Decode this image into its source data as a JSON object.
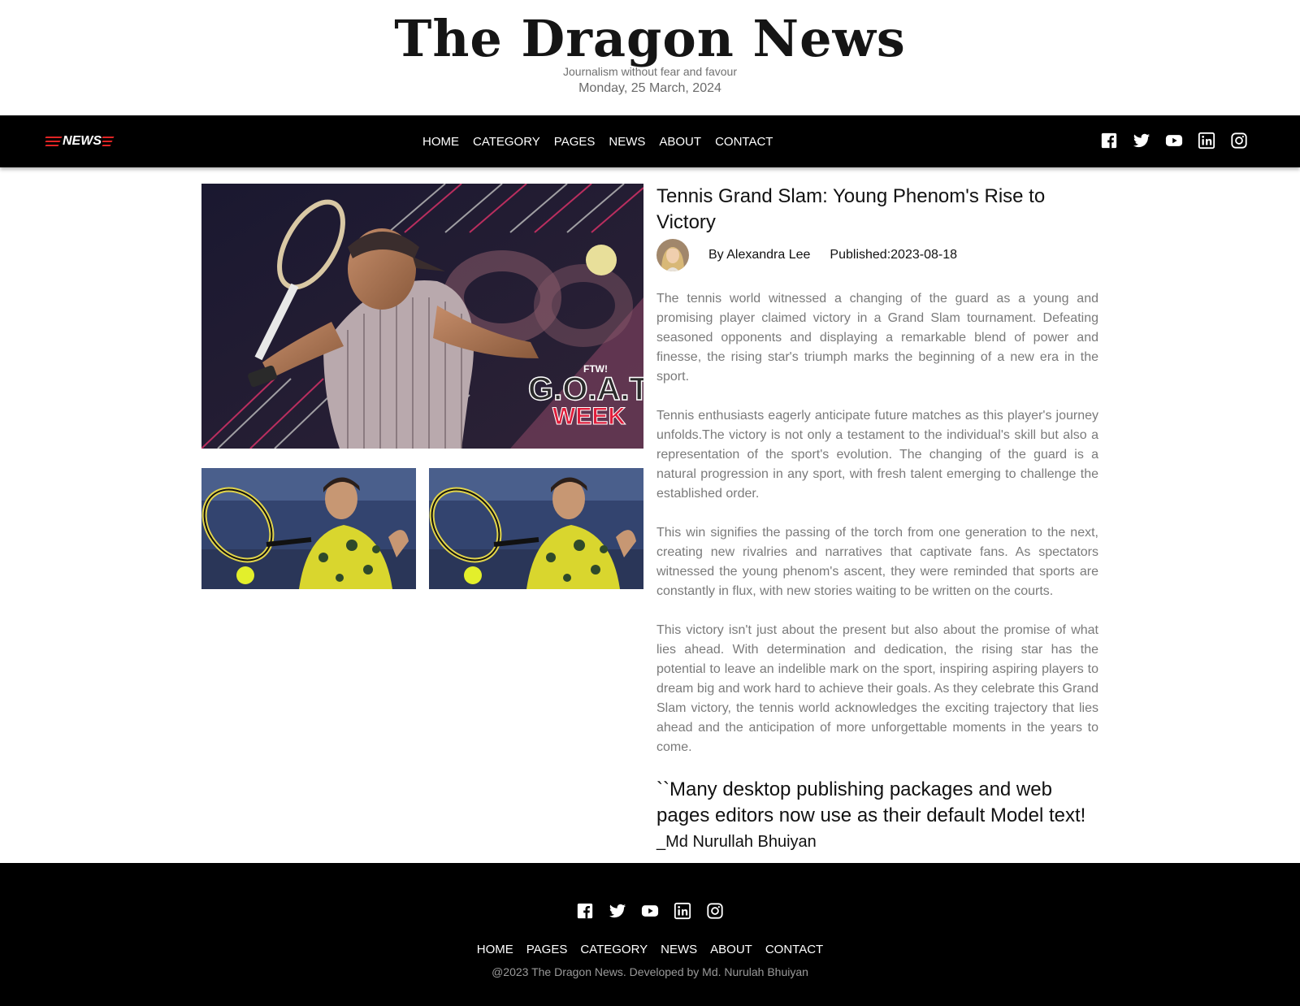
{
  "masthead": {
    "title": "The Dragon News",
    "tagline": "Journalism without fear and favour",
    "date": "Monday, 25 March, 2024"
  },
  "nav": {
    "logo_text": "NEWS",
    "items": [
      "HOME",
      "CATEGORY",
      "PAGES",
      "NEWS",
      "ABOUT",
      "CONTACT"
    ],
    "social_icons": [
      "facebook-icon",
      "twitter-icon",
      "youtube-icon",
      "linkedin-icon",
      "instagram-icon"
    ]
  },
  "hero": {
    "badge_top": "FTW!",
    "badge_main": "G.O.A.T.",
    "badge_sub": "WEEK"
  },
  "article": {
    "headline": "Tennis Grand Slam: Young Phenom's Rise to Victory",
    "author": "By Alexandra Lee",
    "published": "Published:2023-08-18",
    "paragraphs": [
      "The tennis world witnessed a changing of the guard as a young and promising player claimed victory in a Grand Slam tournament. Defeating seasoned opponents and displaying a remarkable blend of power and finesse, the rising star's triumph marks the beginning of a new era in the sport.",
      "Tennis enthusiasts eagerly anticipate future matches as this player's journey unfolds.The victory is not only a testament to the individual's skill but also a representation of the sport's evolution. The changing of the guard is a natural progression in any sport, with fresh talent emerging to challenge the established order.",
      "This win signifies the passing of the torch from one generation to the next, creating new rivalries and narratives that captivate fans. As spectators witnessed the young phenom's ascent, they were reminded that sports are constantly in flux, with new stories waiting to be written on the courts.",
      "This victory isn't just about the present but also about the promise of what lies ahead. With determination and dedication, the rising star has the potential to leave an indelible mark on the sport, inspiring aspiring players to dream big and work hard to achieve their goals. As they celebrate this Grand Slam victory, the tennis world acknowledges the exciting trajectory that lies ahead and the anticipation of more unforgettable moments in the years to come."
    ],
    "quote": "``Many desktop publishing packages and web pages editors now use as their default Model text!",
    "quote_author": "_Md Nurullah Bhuiyan"
  },
  "footer": {
    "social_icons": [
      "facebook-icon",
      "twitter-icon",
      "youtube-icon",
      "linkedin-icon",
      "instagram-icon"
    ],
    "items": [
      "HOME",
      "PAGES",
      "CATEGORY",
      "NEWS",
      "ABOUT",
      "CONTACT"
    ],
    "copyright": "@2023 The Dragon News. Developed by Md. Nurulah Bhuiyan"
  },
  "colors": {
    "nav_bg": "#000000",
    "accent_red": "#e02424",
    "body_text": "#7a7a7a"
  }
}
